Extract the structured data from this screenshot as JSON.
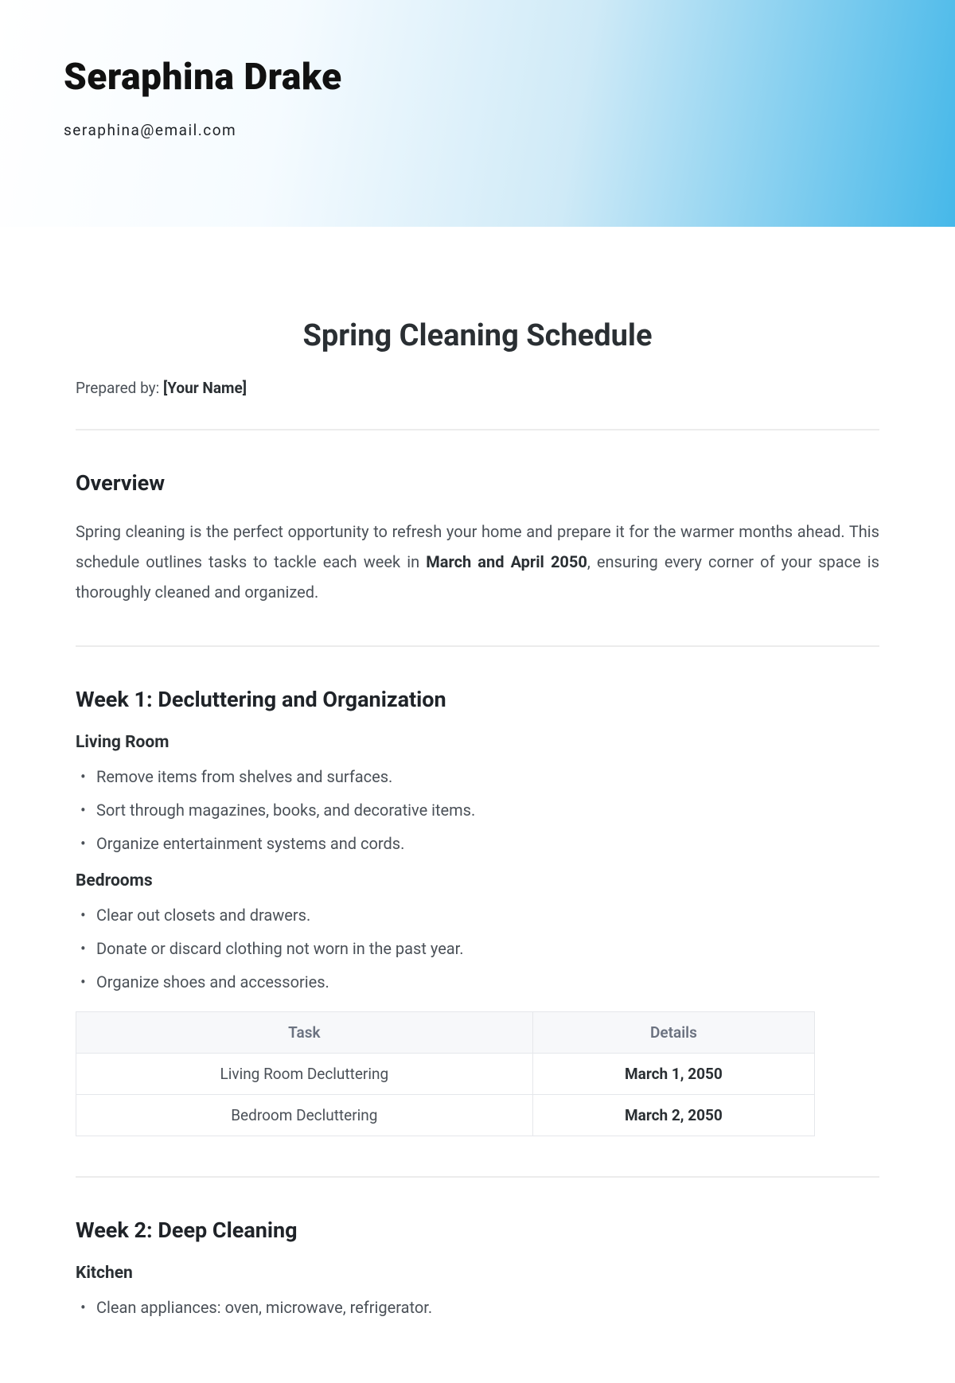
{
  "header": {
    "author_name": "Seraphina Drake",
    "author_email": "seraphina@email.com"
  },
  "document": {
    "title": "Spring Cleaning Schedule",
    "prepared_label": "Prepared by: ",
    "prepared_value": "[Your Name]"
  },
  "overview": {
    "heading": "Overview",
    "text_before_bold": "Spring cleaning is the perfect opportunity to refresh your home and prepare it for the warmer months ahead. This schedule outlines tasks to tackle each week in ",
    "bold_text": "March and April 2050",
    "text_after_bold": ", ensuring every corner of your space is thoroughly cleaned and organized."
  },
  "week1": {
    "heading": "Week 1: Decluttering and Organization",
    "rooms": [
      {
        "name": "Living Room",
        "items": [
          "Remove items from shelves and surfaces.",
          "Sort through magazines, books, and decorative items.",
          "Organize entertainment systems and cords."
        ]
      },
      {
        "name": "Bedrooms",
        "items": [
          "Clear out closets and drawers.",
          "Donate or discard clothing not worn in the past year.",
          "Organize shoes and accessories."
        ]
      }
    ],
    "table": {
      "headers": [
        "Task",
        "Details"
      ],
      "rows": [
        {
          "task": "Living Room Decluttering",
          "detail": "March 1, 2050"
        },
        {
          "task": "Bedroom Decluttering",
          "detail": "March 2, 2050"
        }
      ]
    }
  },
  "week2": {
    "heading": "Week 2: Deep Cleaning",
    "rooms": [
      {
        "name": "Kitchen",
        "items": [
          "Clean appliances: oven, microwave, refrigerator."
        ]
      }
    ]
  }
}
